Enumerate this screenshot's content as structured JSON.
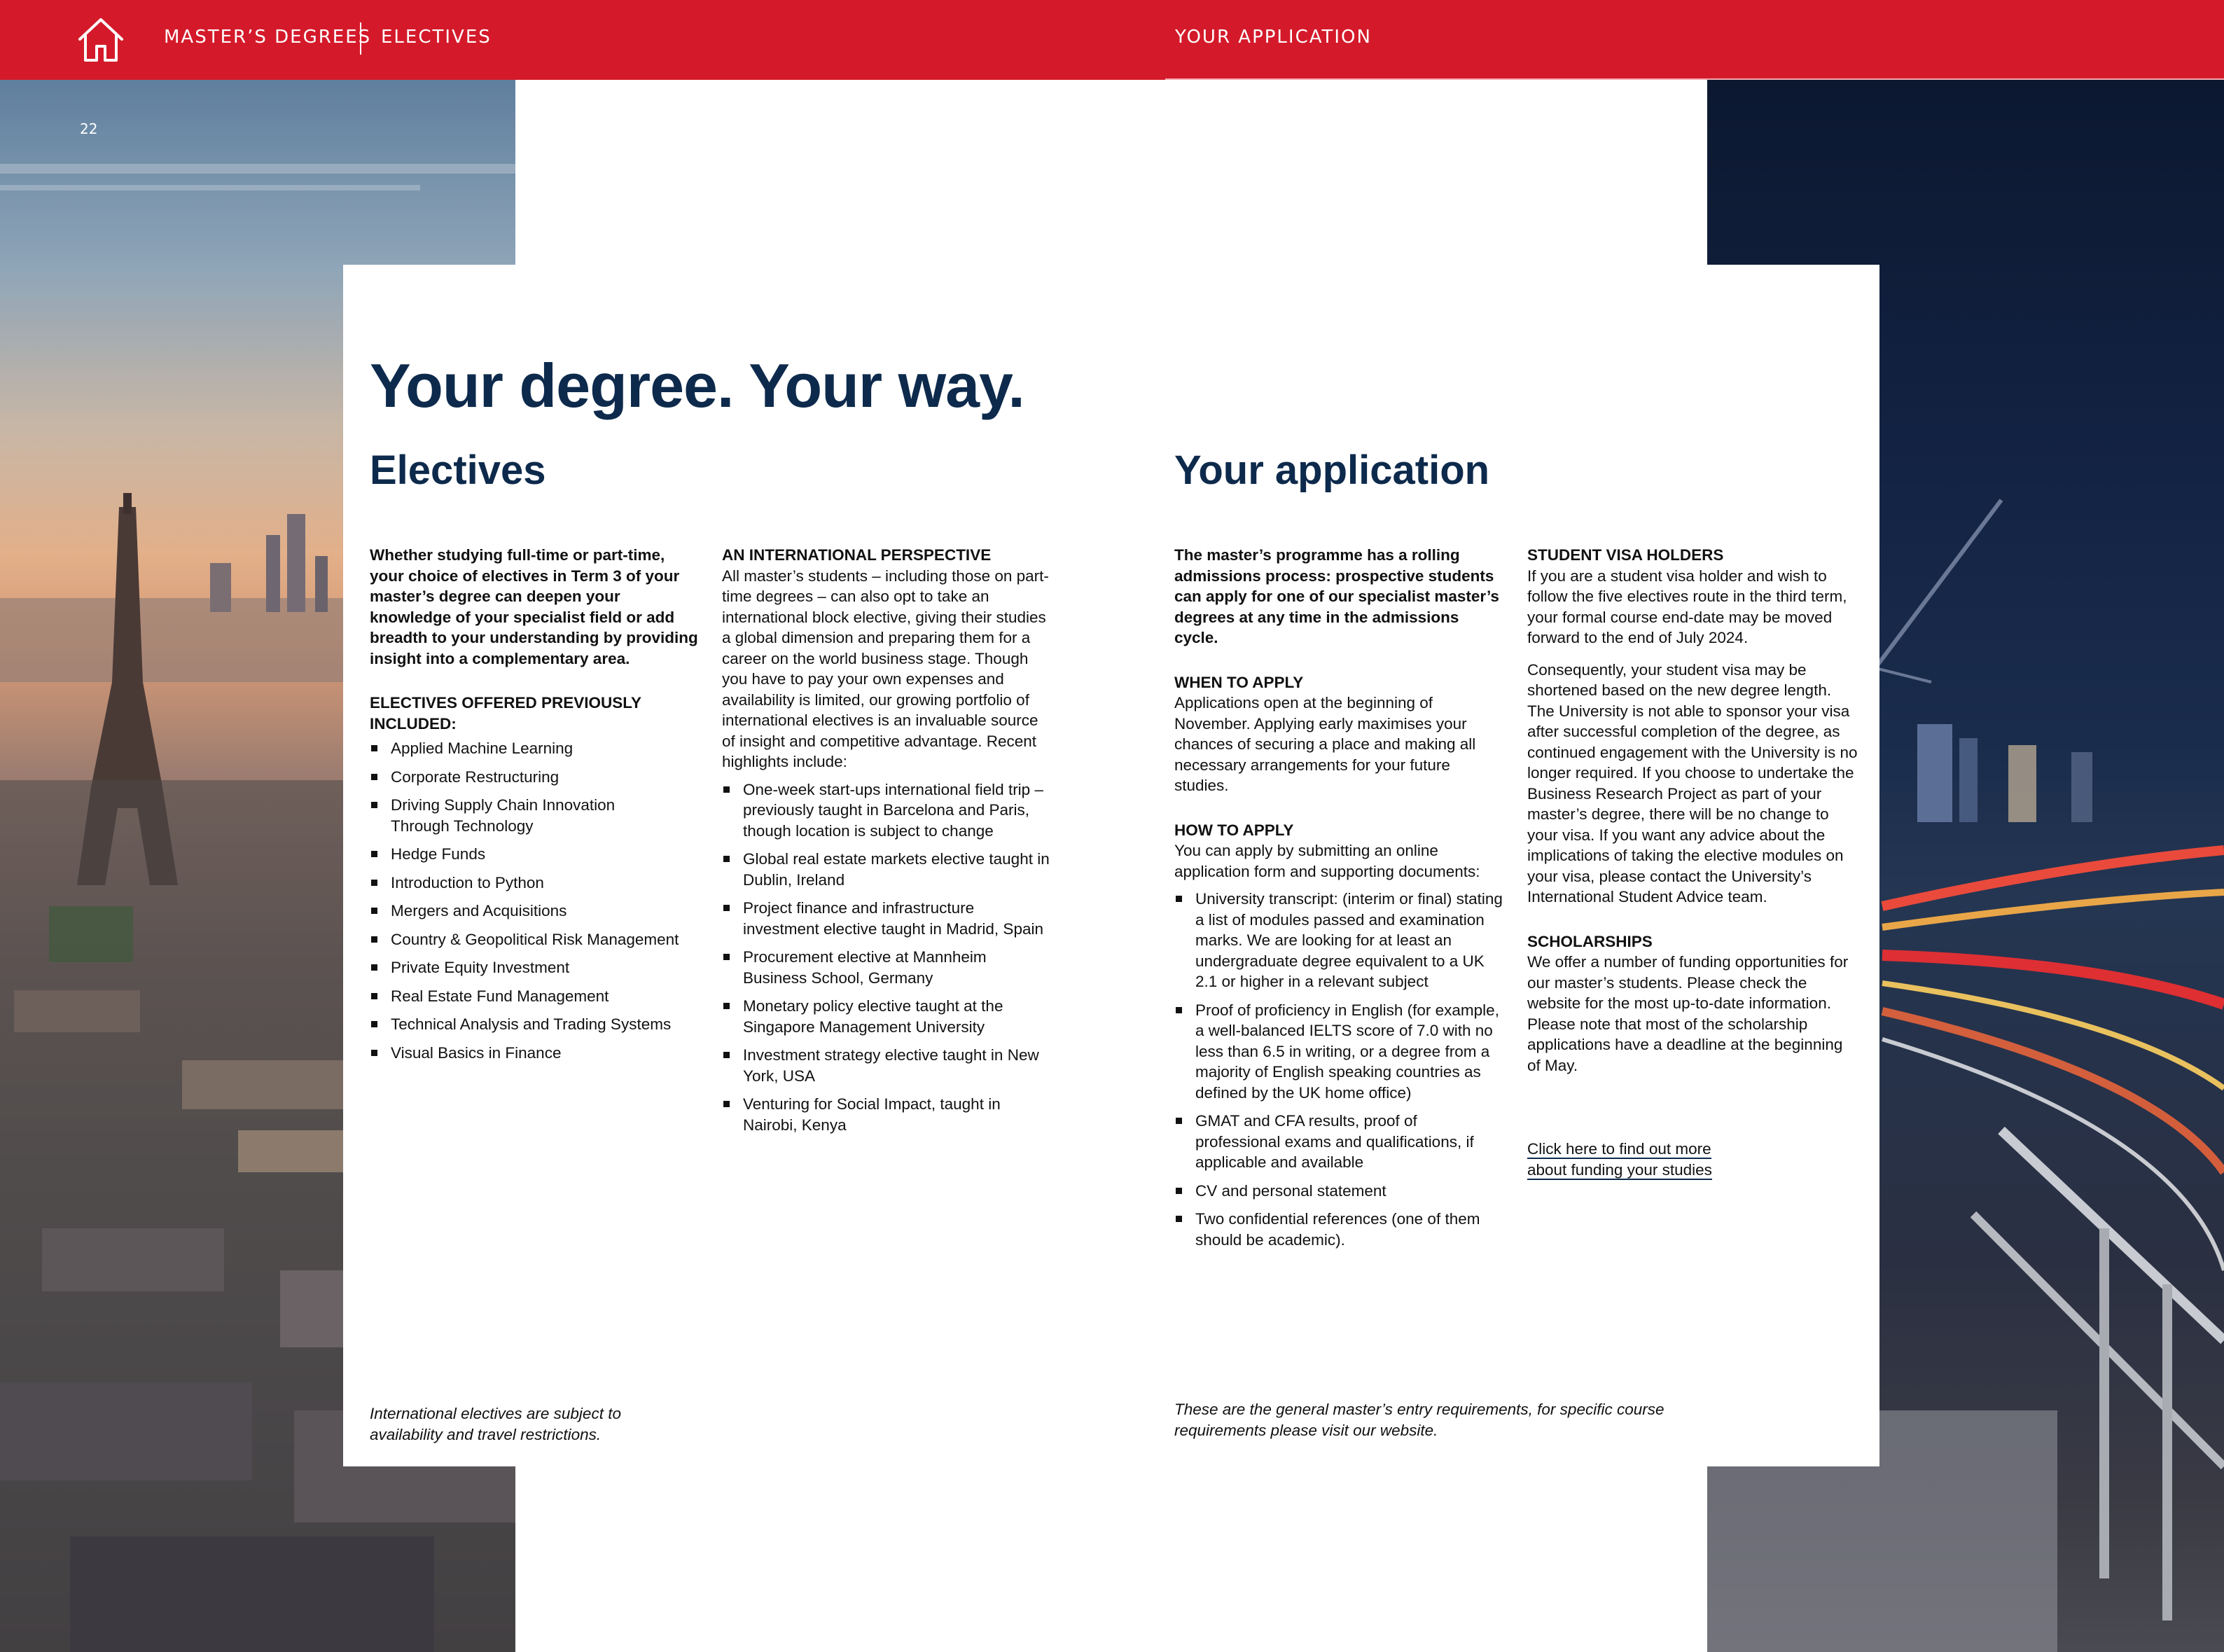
{
  "header": {
    "nav": [
      "MASTER’S DEGREES",
      "ELECTIVES"
    ],
    "right_nav": "YOUR APPLICATION"
  },
  "page_number": "22",
  "headline": "Your degree. Your way.",
  "electives": {
    "title": "Electives",
    "intro": "Whether studying full-time or part-time, your choice of electives in Term 3 of your master’s degree can deepen your knowledge of your specialist field or add breadth to your understanding by providing insight into a complementary area.",
    "offered_heading": "ELECTIVES OFFERED PREVIOUSLY INCLUDED:",
    "offered": [
      "Applied Machine Learning",
      "Corporate Restructuring",
      "Driving Supply Chain Innovation Through Technology",
      "Hedge Funds",
      "Introduction to Python",
      "Mergers and Acquisitions",
      "Country & Geopolitical Risk Management",
      "Private Equity Investment",
      "Real Estate Fund Management",
      "Technical Analysis and Trading Systems",
      "Visual Basics in Finance"
    ],
    "intl_heading": "AN INTERNATIONAL PERSPECTIVE",
    "intl_body": "All master’s students – including those on part-time degrees – can also opt to take an international block elective, giving their studies a global dimension and preparing them for a career on the world business stage. Though you have to pay your own expenses and availability is limited, our growing portfolio of international electives is an invaluable source of insight and competitive advantage. Recent highlights include:",
    "intl_items": [
      "One-week start-ups international field trip – previously taught in Barcelona and Paris, though location is subject to change",
      "Global real estate markets elective taught in Dublin, Ireland",
      "Project finance and infrastructure investment elective taught in Madrid, Spain",
      "Procurement elective at Mannheim Business School, Germany",
      "Monetary policy elective taught at the Singapore Management University",
      "Investment strategy elective taught in New York, USA",
      "Venturing for Social Impact, taught in Nairobi, Kenya"
    ],
    "note": "International electives are subject to availability and travel restrictions."
  },
  "application": {
    "title": "Your application",
    "intro": "The master’s programme has a rolling admissions process: prospective students can apply for one of our specialist master’s degrees at any time in the admissions cycle.",
    "when_heading": "WHEN TO APPLY",
    "when_body": "Applications open at the beginning of November. Applying early maximises your chances of securing a place and making all necessary arrangements for your future studies.",
    "how_heading": "HOW TO APPLY",
    "how_body": "You can apply by submitting an online application form and supporting documents:",
    "how_items": [
      "University transcript: (interim or final) stating a list of modules passed and examination marks. We are looking for at least an undergraduate degree equivalent to a UK 2.1 or higher in a relevant subject",
      "Proof of proficiency in English (for example, a well-balanced IELTS score of 7.0 with no less than 6.5 in writing, or a degree from a majority of English speaking countries as defined by the UK home office)",
      "GMAT and CFA results, proof of professional exams and qualifications, if applicable and available",
      "CV and personal statement",
      "Two confidential references (one of them should be academic)."
    ],
    "visa_heading": "STUDENT VISA HOLDERS",
    "visa_body_1": "If you are a student visa holder and wish to follow the five electives route in the third term, your formal course end-date may be moved forward to the end of July 2024.",
    "visa_body_2": "Consequently, your student visa may be shortened based on the new degree length. The University is not able to sponsor your visa after successful completion of the degree, as continued engagement with the University is no longer required. If you choose to undertake the Business Research Project as part of your master’s degree, there will be no change to your visa. If you want any advice about the implications of taking the elective modules on your visa, please contact the University’s International Student Advice team.",
    "scholarships_heading": "SCHOLARSHIPS",
    "scholarships_body": "We offer a number of funding opportunities for our master’s students. Please check the website for the most up-to-date information. Please note that most of the scholarship applications have a deadline at the beginning of May.",
    "link_line_1": "Click here to find out more",
    "link_line_2": "about funding your studies",
    "note": "These are the general master’s entry requirements, for specific course requirements please visit our website."
  },
  "colors": {
    "brand_red": "#d41a2a",
    "heading_navy": "#0d2a4c"
  }
}
